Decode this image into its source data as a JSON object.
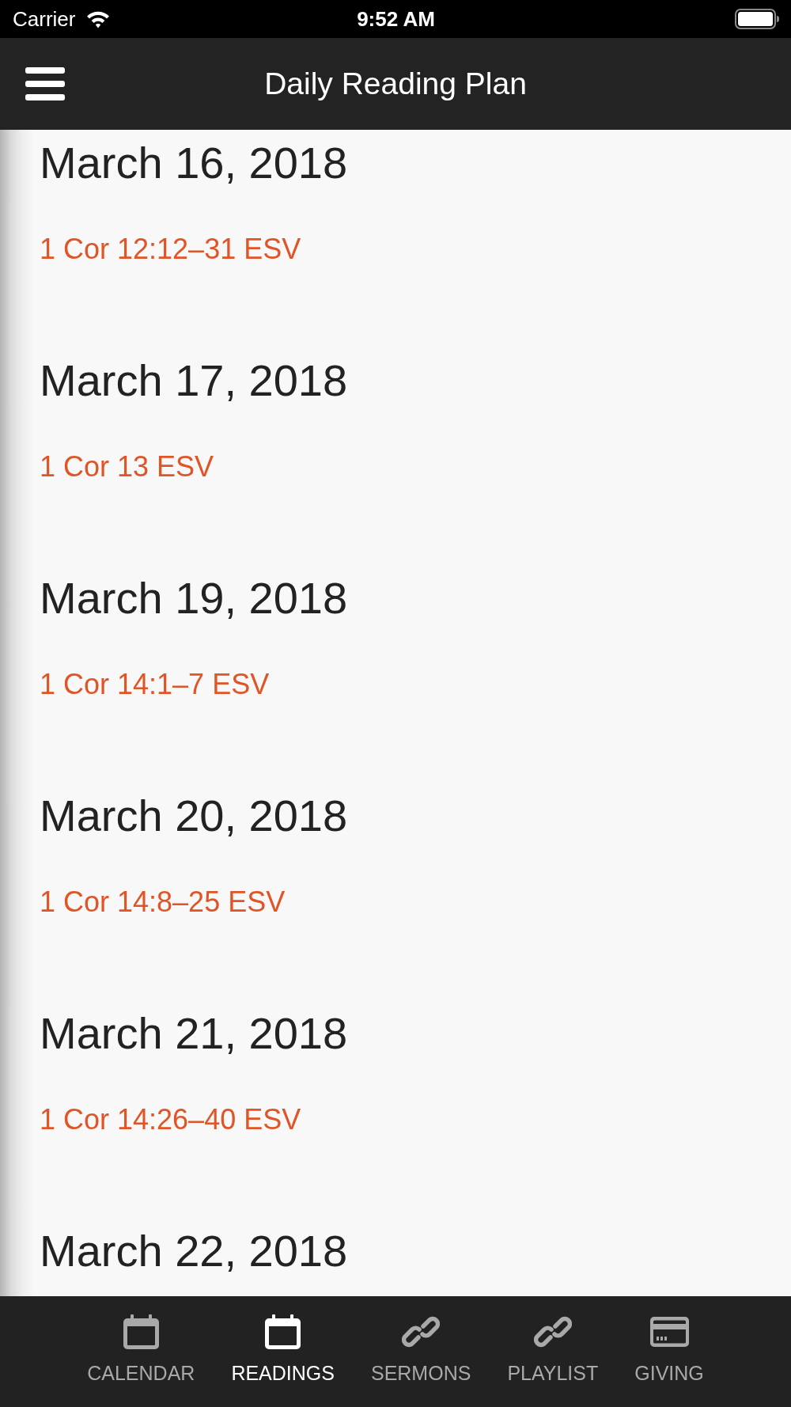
{
  "status_bar": {
    "carrier": "Carrier",
    "time": "9:52 AM"
  },
  "header": {
    "title": "Daily Reading Plan"
  },
  "readings": [
    {
      "date": "March 16, 2018",
      "reference": "1 Cor 12:12–31 ESV"
    },
    {
      "date": "March 17, 2018",
      "reference": "1 Cor 13 ESV"
    },
    {
      "date": "March 19, 2018",
      "reference": "1 Cor 14:1–7 ESV"
    },
    {
      "date": "March 20, 2018",
      "reference": "1 Cor 14:8–25 ESV"
    },
    {
      "date": "March 21, 2018",
      "reference": "1 Cor 14:26–40 ESV"
    },
    {
      "date": "March 22, 2018"
    }
  ],
  "tab_bar": {
    "tabs": [
      {
        "label": "CALENDAR",
        "kind": "calendar",
        "selected": false
      },
      {
        "label": "READINGS",
        "kind": "calendar",
        "selected": true
      },
      {
        "label": "SERMONS",
        "kind": "link",
        "selected": false
      },
      {
        "label": "PLAYLIST",
        "kind": "link",
        "selected": false
      },
      {
        "label": "GIVING",
        "kind": "card",
        "selected": false
      }
    ]
  }
}
